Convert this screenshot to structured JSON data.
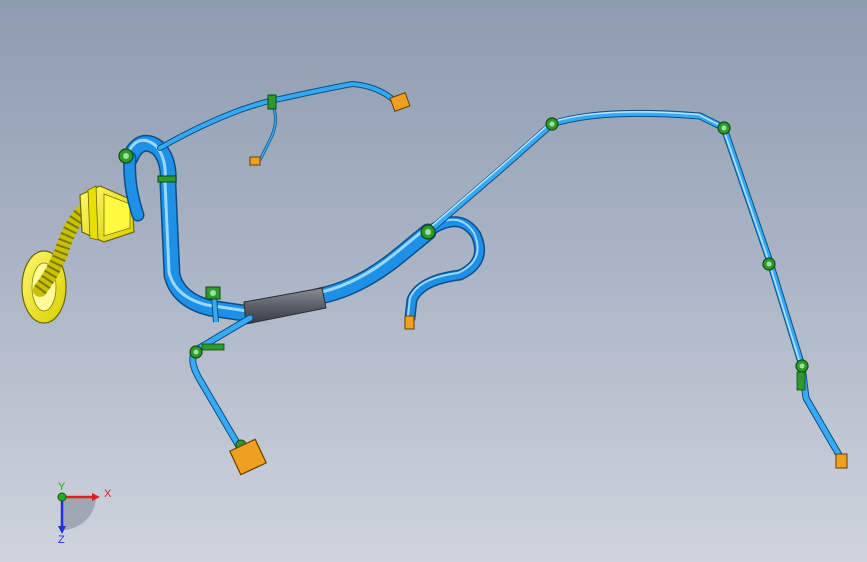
{
  "viewport": {
    "colors": {
      "background_top": "#8e9bb0",
      "background_bottom": "#cfd4dd",
      "harness_blue": "#1e90e6",
      "harness_highlight": "#8fd4ff",
      "clip_green": "#2e9a2e",
      "connector_yellow": "#f2ea00",
      "terminal_orange": "#f0a020",
      "sleeve_gray": "#5a5f66"
    }
  },
  "triad": {
    "x_label": "X",
    "y_label": "Y",
    "z_label": "Z",
    "x_color": "#e02020",
    "y_color": "#20b020",
    "z_color": "#2030e0"
  }
}
